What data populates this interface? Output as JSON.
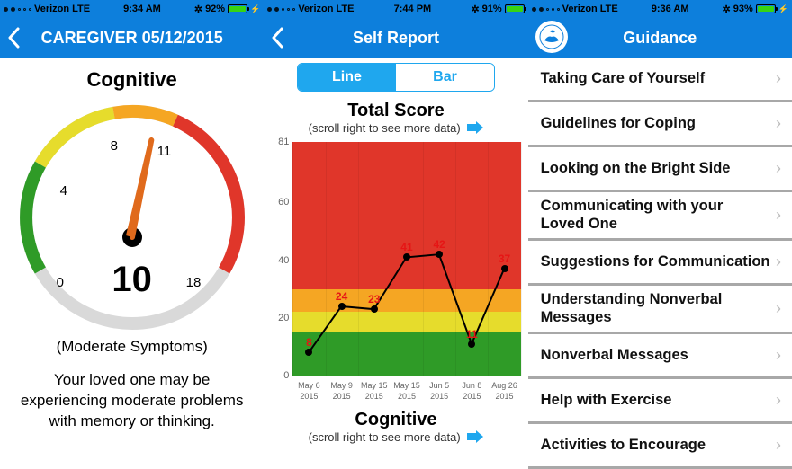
{
  "screen1": {
    "status": {
      "signal": "oo",
      "carrier": "Verizon",
      "net": "LTE",
      "time": "9:34 AM",
      "bt": "⌨ ⚲",
      "batt_pct": "92%",
      "batt_fill": 92,
      "icons_right": "⊛ ✻"
    },
    "nav_title": "CAREGIVER 05/12/2015",
    "section": "Cognitive",
    "value": "10",
    "caption": "(Moderate Symptoms)",
    "desc": "Your loved one may be experiencing moderate problems with memory or thinking.",
    "ticks": {
      "t0": "0",
      "t1": "4",
      "t2": "8",
      "t3": "11",
      "t4": "18"
    }
  },
  "screen2": {
    "status": {
      "carrier": "Verizon",
      "net": "LTE",
      "time": "7:44 PM",
      "batt_pct": "91%",
      "batt_fill": 91
    },
    "nav_title": "Self Report",
    "seg": {
      "a": "Line",
      "b": "Bar"
    },
    "chart1_title": "Total Score",
    "scroll_hint": "(scroll right to see more data)",
    "chart2_title": "Cognitive",
    "ylabels": {
      "y0": "0",
      "y1": "20",
      "y2": "40",
      "y3": "60",
      "y4": "81"
    },
    "x": [
      "May 6 2015",
      "May 9 2015",
      "May 15 2015",
      "May 15 2015",
      "Jun 5 2015",
      "Jun 8 2015",
      "Aug 26 2015"
    ]
  },
  "chart_data": {
    "type": "line",
    "title": "Total Score",
    "xlabel": "",
    "ylabel": "",
    "ylim": [
      0,
      81
    ],
    "bands": [
      {
        "from": 0,
        "to": 15,
        "color": "#2f9b27"
      },
      {
        "from": 15,
        "to": 22,
        "color": "#e6dc2c"
      },
      {
        "from": 22,
        "to": 30,
        "color": "#f5a623"
      },
      {
        "from": 30,
        "to": 81,
        "color": "#e0362a"
      }
    ],
    "categories": [
      "May 6 2015",
      "May 9 2015",
      "May 15 2015",
      "May 15 2015",
      "Jun 5 2015",
      "Jun 8 2015",
      "Aug 26 2015"
    ],
    "values": [
      8,
      24,
      23,
      41,
      42,
      11,
      37
    ]
  },
  "screen3": {
    "status": {
      "carrier": "Verizon",
      "net": "LTE",
      "time": "9:36 AM",
      "batt_pct": "93%",
      "batt_fill": 93
    },
    "nav_title": "Guidance",
    "items": [
      "Taking Care of Yourself",
      "Guidelines for Coping",
      "Looking on the Bright Side",
      "Communicating with your Loved One",
      "Suggestions for Communication",
      "Understanding Nonverbal Messages",
      "Nonverbal Messages",
      "Help with Exercise",
      "Activities to Encourage"
    ]
  }
}
